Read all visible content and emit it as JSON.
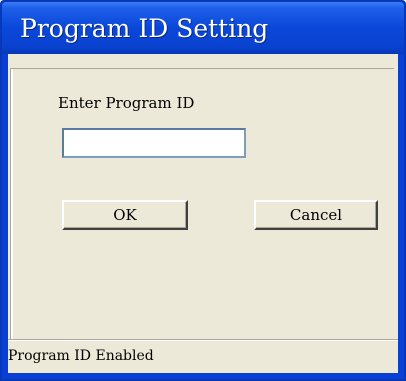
{
  "window": {
    "title": "Program ID Setting"
  },
  "form": {
    "label": "Enter Program ID",
    "program_id_value": "",
    "ok_label": "OK",
    "cancel_label": "Cancel"
  },
  "status_bar": {
    "text": "Program ID Enabled"
  },
  "colors": {
    "titlebar": "#0a47d9",
    "dialog_background": "#ece9d8",
    "input_border": "#7f9db9"
  }
}
